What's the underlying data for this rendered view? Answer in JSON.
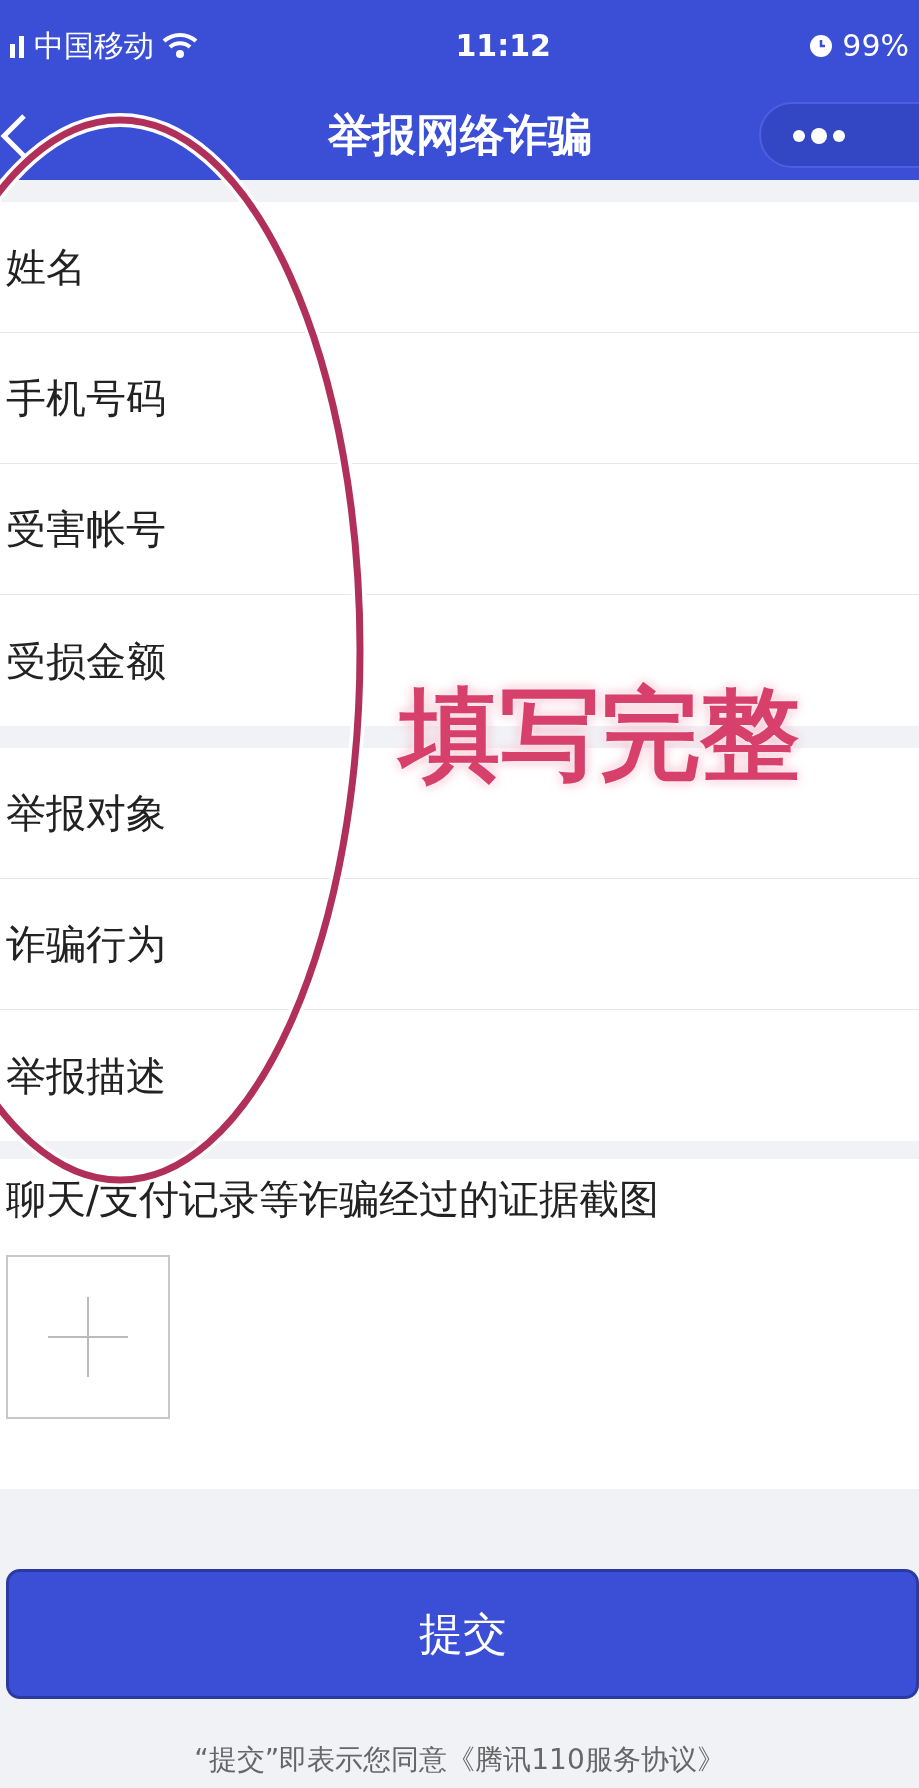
{
  "status_bar": {
    "carrier": "中国移动",
    "time": "11:12",
    "battery": "99%"
  },
  "nav_bar": {
    "title": "举报网络诈骗"
  },
  "form_sections": [
    {
      "fields": [
        {
          "label": "姓名"
        },
        {
          "label": "手机号码"
        },
        {
          "label": "受害帐号"
        },
        {
          "label": "受损金额"
        }
      ]
    },
    {
      "fields": [
        {
          "label": "举报对象"
        },
        {
          "label": "诈骗行为"
        },
        {
          "label": "举报描述"
        }
      ]
    }
  ],
  "evidence": {
    "label": "聊天/支付记录等诈骗经过的证据截图"
  },
  "submit_button": {
    "label": "提交"
  },
  "agreement": "“提交”即表示您同意《腾讯110服务协议》",
  "annotation": {
    "text": "填写完整"
  }
}
